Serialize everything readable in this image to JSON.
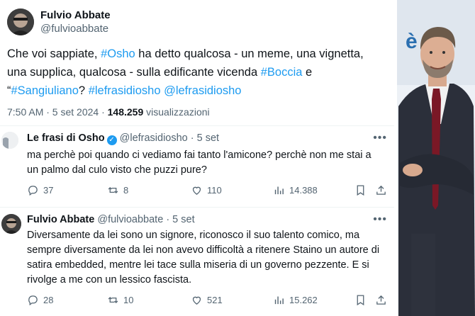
{
  "main_tweet": {
    "author_name": "Fulvio Abbate",
    "author_handle": "@fulvioabbate",
    "text": {
      "line1_a": "Che voi sappiate, ",
      "tag_osho": "#Osho",
      "line1_b": " ha detto qualcosa - un meme, una vignetta,",
      "line2_a": "una supplica, qualcosa - sulla edificante vicenda ",
      "tag_boccia": "#Boccia",
      "line2_b": " e",
      "line3_a": "“",
      "tag_sangiuliano": "#Sangiuliano",
      "line3_b": "? ",
      "tag_lefrasidiosho": "#lefrasidiosho",
      "mention": "@lefrasidiosho"
    },
    "time": "7:50 AM · 5 set 2024 · ",
    "views_count": "148.259",
    "views_label": " visualizzazioni"
  },
  "replies": [
    {
      "author_name": "Le frasi di Osho",
      "verified": true,
      "author_handle": "@lefrasidiosho",
      "date": "· 5 set",
      "text": "ma perchè poi quando ci vediamo fai tanto l'amicone? perchè non me stai a un palmo dal culo visto che puzzi pure?",
      "replies": "37",
      "reposts": "8",
      "likes": "110",
      "views": "14.388"
    },
    {
      "author_name": "Fulvio Abbate",
      "verified": false,
      "author_handle": "@fulvioabbate",
      "date": "· 5 set",
      "text": "Diversamente da lei sono un signore, riconosco il suo talento comico, ma sempre diversamente da lei non avevo difficoltà a ritenere Staino un autore di satira embedded, mentre lei tace sulla miseria di un governo pezzente. E si rivolge a me con un lessico fascista.",
      "replies": "28",
      "reposts": "10",
      "likes": "521",
      "views": "15.262"
    }
  ],
  "more_label": "•••",
  "photo": {
    "sign_text": "è",
    "sign_color": "#2a6fb0",
    "suit_color": "#2b2f3a",
    "tie_color": "#7a1826"
  }
}
